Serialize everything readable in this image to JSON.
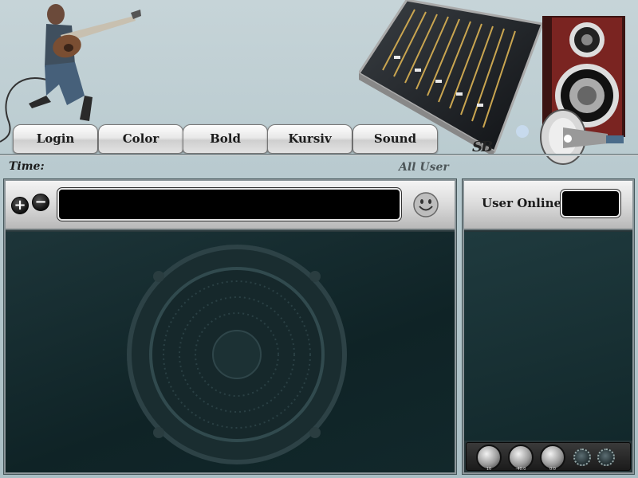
{
  "menu": {
    "items": [
      {
        "label": "Login"
      },
      {
        "label": "Color"
      },
      {
        "label": "Bold"
      },
      {
        "label": "Kursiv"
      },
      {
        "label": "Sound"
      }
    ]
  },
  "status": {
    "time_label": "Time:",
    "all_user_label": "All User"
  },
  "chat": {
    "zoom_in_symbol": "+",
    "zoom_out_symbol": "−",
    "message_value": ""
  },
  "users": {
    "title": "User Online",
    "count": ""
  },
  "knobs": {
    "labels": [
      "10",
      "-40.0",
      "0.0"
    ]
  },
  "logo_text": "SB",
  "colors": {
    "background": "#b7c9ce",
    "panel_dark": "#12282b",
    "button_face": "#e2e2e2",
    "input_black": "#000000"
  },
  "icons": [
    "plus-icon",
    "minus-icon",
    "smiley-icon",
    "megaphone-icon",
    "speaker-icon"
  ]
}
